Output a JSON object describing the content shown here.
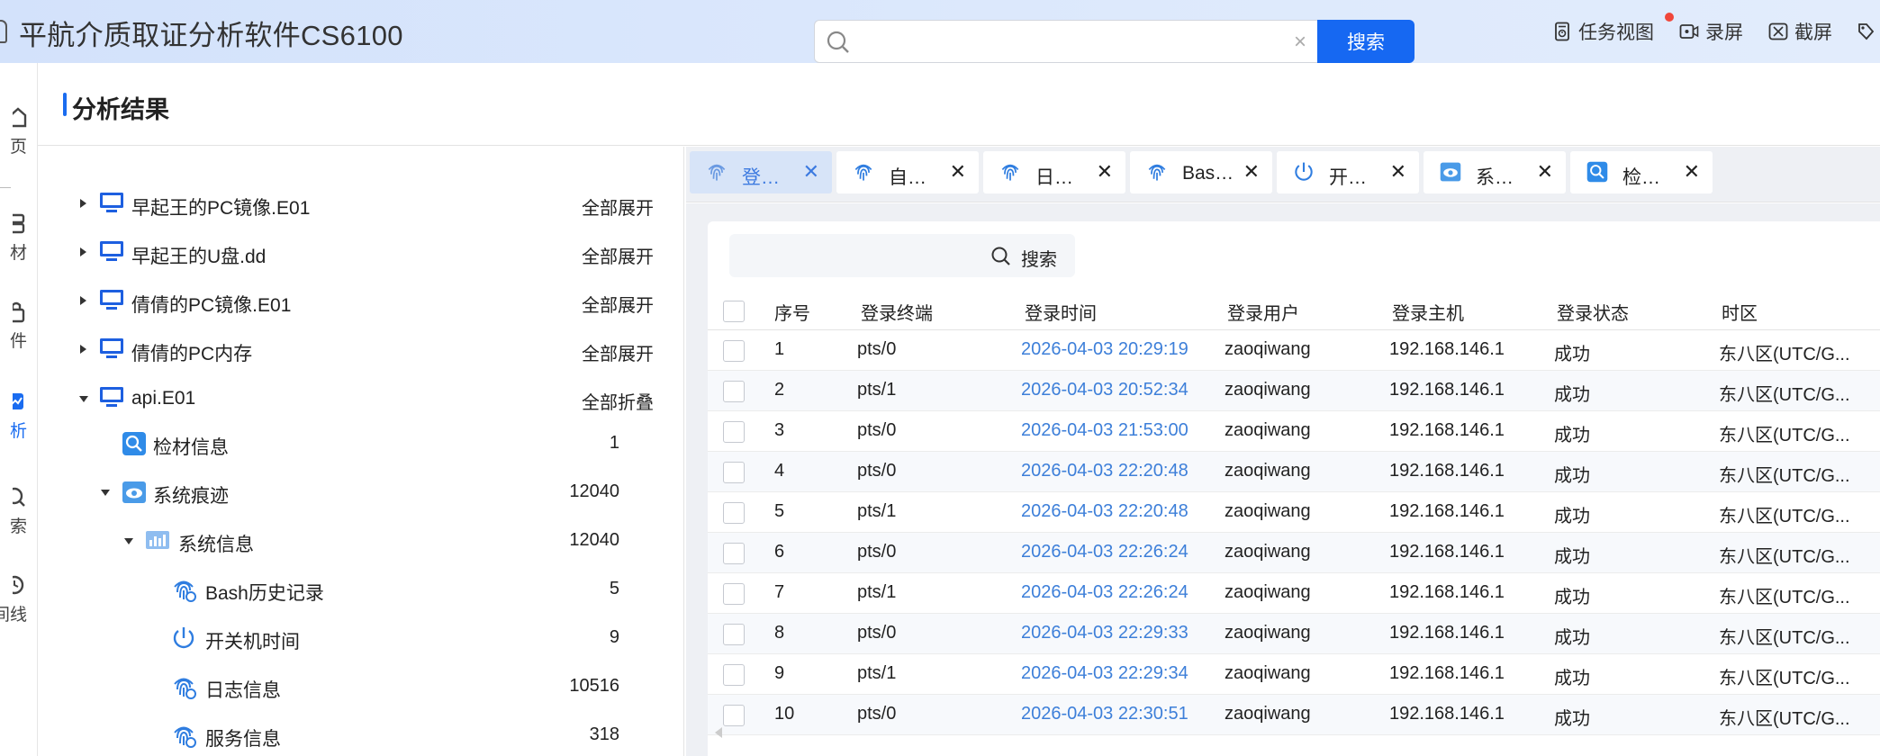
{
  "app": {
    "title": "平航介质取证分析软件CS6100",
    "actions": [
      {
        "label": "任务视图",
        "icon": "task-view-icon",
        "badge": true
      },
      {
        "label": "录屏",
        "icon": "record-screen-icon"
      },
      {
        "label": "截屏",
        "icon": "screenshot-icon"
      }
    ]
  },
  "sidebar": {
    "items": [
      {
        "label": "页",
        "icon": "home-icon"
      },
      {
        "label": "材",
        "icon": "evidence-icon"
      },
      {
        "label": "件",
        "icon": "case-icon"
      },
      {
        "label": "析",
        "icon": "analysis-icon",
        "active": true
      },
      {
        "label": "索",
        "icon": "search-icon"
      },
      {
        "label": "间线",
        "icon": "timeline-icon"
      }
    ]
  },
  "results": {
    "title": "分析结果",
    "search": {
      "placeholder": "",
      "value": "",
      "button_label": "搜索"
    }
  },
  "tree": {
    "nodes": [
      {
        "label": "早起王的PC镜像.E01",
        "action": "全部展开",
        "icon": "computer-icon",
        "expand": "collapsed",
        "level": 0
      },
      {
        "label": "早起王的U盘.dd",
        "action": "全部展开",
        "icon": "computer-icon",
        "expand": "collapsed",
        "level": 0
      },
      {
        "label": "倩倩的PC镜像.E01",
        "action": "全部展开",
        "icon": "computer-icon",
        "expand": "collapsed",
        "level": 0
      },
      {
        "label": "倩倩的PC内存",
        "action": "全部展开",
        "icon": "computer-icon",
        "expand": "collapsed",
        "level": 0
      },
      {
        "label": "api.E01",
        "action": "全部折叠",
        "icon": "computer-icon",
        "expand": "expanded",
        "level": 0
      },
      {
        "label": "检材信息",
        "count": "1",
        "icon": "evidence-info-icon",
        "expand": "none",
        "level": 1
      },
      {
        "label": "系统痕迹",
        "count": "12040",
        "icon": "system-trace-icon",
        "expand": "expanded",
        "level": 1
      },
      {
        "label": "系统信息",
        "count": "12040",
        "icon": "system-info-icon",
        "expand": "expanded",
        "level": 2
      },
      {
        "label": "Bash历史记录",
        "count": "5",
        "icon": "fingerprint-icon",
        "expand": "none",
        "level": 3
      },
      {
        "label": "开关机时间",
        "count": "9",
        "icon": "power-icon",
        "expand": "none",
        "level": 3
      },
      {
        "label": "日志信息",
        "count": "10516",
        "icon": "fingerprint-icon",
        "expand": "none",
        "level": 3
      },
      {
        "label": "服务信息",
        "count": "318",
        "icon": "fingerprint-icon",
        "expand": "none",
        "level": 3
      }
    ]
  },
  "tabs": [
    {
      "label": "登…",
      "icon": "fingerprint-icon",
      "active": true
    },
    {
      "label": "自…",
      "icon": "fingerprint-icon"
    },
    {
      "label": "日…",
      "icon": "fingerprint-icon"
    },
    {
      "label": "Bas…",
      "icon": "fingerprint-icon"
    },
    {
      "label": "开…",
      "icon": "power-icon"
    },
    {
      "label": "系…",
      "icon": "system-trace-icon"
    },
    {
      "label": "检…",
      "icon": "evidence-info-icon"
    }
  ],
  "table": {
    "search_label": "搜索",
    "columns": [
      "序号",
      "登录终端",
      "登录时间",
      "登录用户",
      "登录主机",
      "登录状态",
      "时区"
    ],
    "rows": [
      [
        "1",
        "pts/0",
        "2026-04-03 20:29:19",
        "zaoqiwang",
        "192.168.146.1",
        "成功",
        "东八区(UTC/G..."
      ],
      [
        "2",
        "pts/1",
        "2026-04-03 20:52:34",
        "zaoqiwang",
        "192.168.146.1",
        "成功",
        "东八区(UTC/G..."
      ],
      [
        "3",
        "pts/0",
        "2026-04-03 21:53:00",
        "zaoqiwang",
        "192.168.146.1",
        "成功",
        "东八区(UTC/G..."
      ],
      [
        "4",
        "pts/0",
        "2026-04-03 22:20:48",
        "zaoqiwang",
        "192.168.146.1",
        "成功",
        "东八区(UTC/G..."
      ],
      [
        "5",
        "pts/1",
        "2026-04-03 22:20:48",
        "zaoqiwang",
        "192.168.146.1",
        "成功",
        "东八区(UTC/G..."
      ],
      [
        "6",
        "pts/0",
        "2026-04-03 22:26:24",
        "zaoqiwang",
        "192.168.146.1",
        "成功",
        "东八区(UTC/G..."
      ],
      [
        "7",
        "pts/1",
        "2026-04-03 22:26:24",
        "zaoqiwang",
        "192.168.146.1",
        "成功",
        "东八区(UTC/G..."
      ],
      [
        "8",
        "pts/0",
        "2026-04-03 22:29:33",
        "zaoqiwang",
        "192.168.146.1",
        "成功",
        "东八区(UTC/G..."
      ],
      [
        "9",
        "pts/1",
        "2026-04-03 22:29:34",
        "zaoqiwang",
        "192.168.146.1",
        "成功",
        "东八区(UTC/G..."
      ],
      [
        "10",
        "pts/0",
        "2026-04-03 22:30:51",
        "zaoqiwang",
        "192.168.146.1",
        "成功",
        "东八区(UTC/G..."
      ]
    ]
  },
  "colors": {
    "accent": "#1668f2",
    "link": "#3d7fd9",
    "active_tab": "#d7e4f8",
    "badge": "#f0463a"
  }
}
